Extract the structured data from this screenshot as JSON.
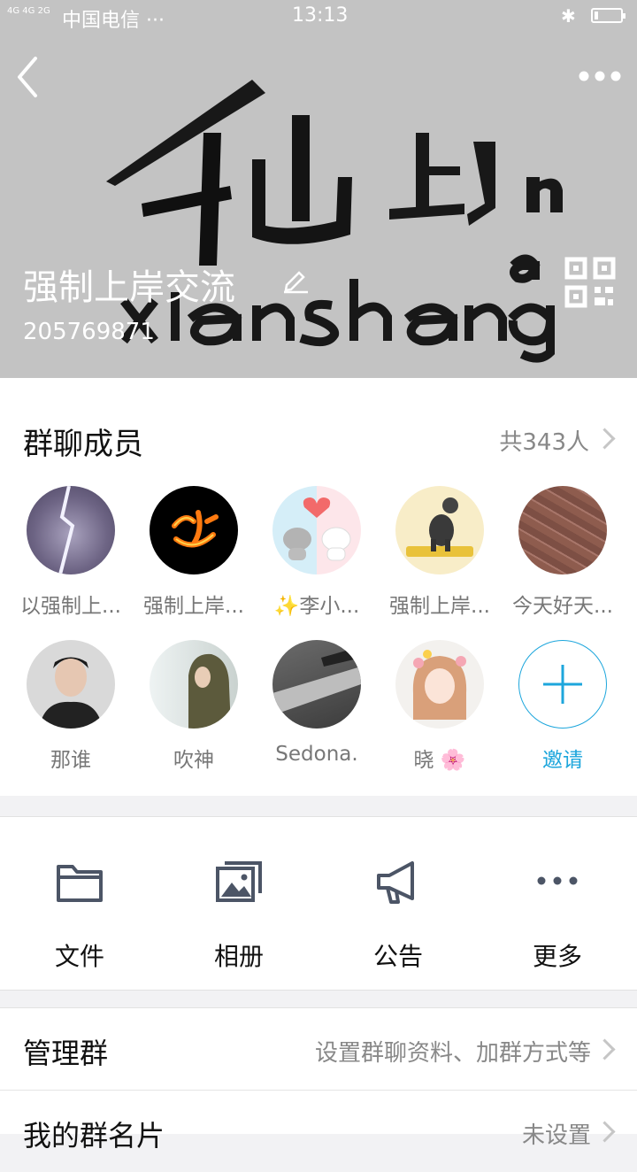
{
  "status_bar": {
    "network": "4G 4G\n2G",
    "carrier": "中国电信 ···",
    "time": "13:13",
    "bluetooth_icon": "bluetooth-icon",
    "battery_level": 0.15
  },
  "header": {
    "group_name": "强制上岸交流",
    "group_id": "205769871",
    "cover_text": {
      "hanzi": "仙山上岸",
      "pinyin": "xiānshàng"
    }
  },
  "members": {
    "title": "群聊成员",
    "count_label": "共343人",
    "list": [
      {
        "name": "以强制上...",
        "avatar": "lightning-photo"
      },
      {
        "name": "强制上岸...",
        "avatar": "fire-calligraphy"
      },
      {
        "name": "✨李小...",
        "avatar": "cartoon-cats-heart"
      },
      {
        "name": "强制上岸...",
        "avatar": "cartoon-dog"
      },
      {
        "name": "今天好天...",
        "avatar": "brick-pavement"
      },
      {
        "name": "那谁",
        "avatar": "young-man-portrait"
      },
      {
        "name": "吹神",
        "avatar": "hooded-figure"
      },
      {
        "name": "Sedona.",
        "avatar": "street-photo"
      },
      {
        "name": "晓 🌸",
        "avatar": "girl-flowers"
      }
    ],
    "invite_label": "邀请"
  },
  "actions": [
    {
      "label": "文件",
      "icon": "folder-icon"
    },
    {
      "label": "相册",
      "icon": "photo-album-icon"
    },
    {
      "label": "公告",
      "icon": "megaphone-icon"
    },
    {
      "label": "更多",
      "icon": "more-dots-icon"
    }
  ],
  "settings": {
    "manage": {
      "title": "管理群",
      "value": "设置群聊资料、加群方式等"
    },
    "card": {
      "title": "我的群名片",
      "value": "未设置"
    }
  },
  "colors": {
    "accent": "#1da6dc",
    "secondary_text": "#888888"
  }
}
